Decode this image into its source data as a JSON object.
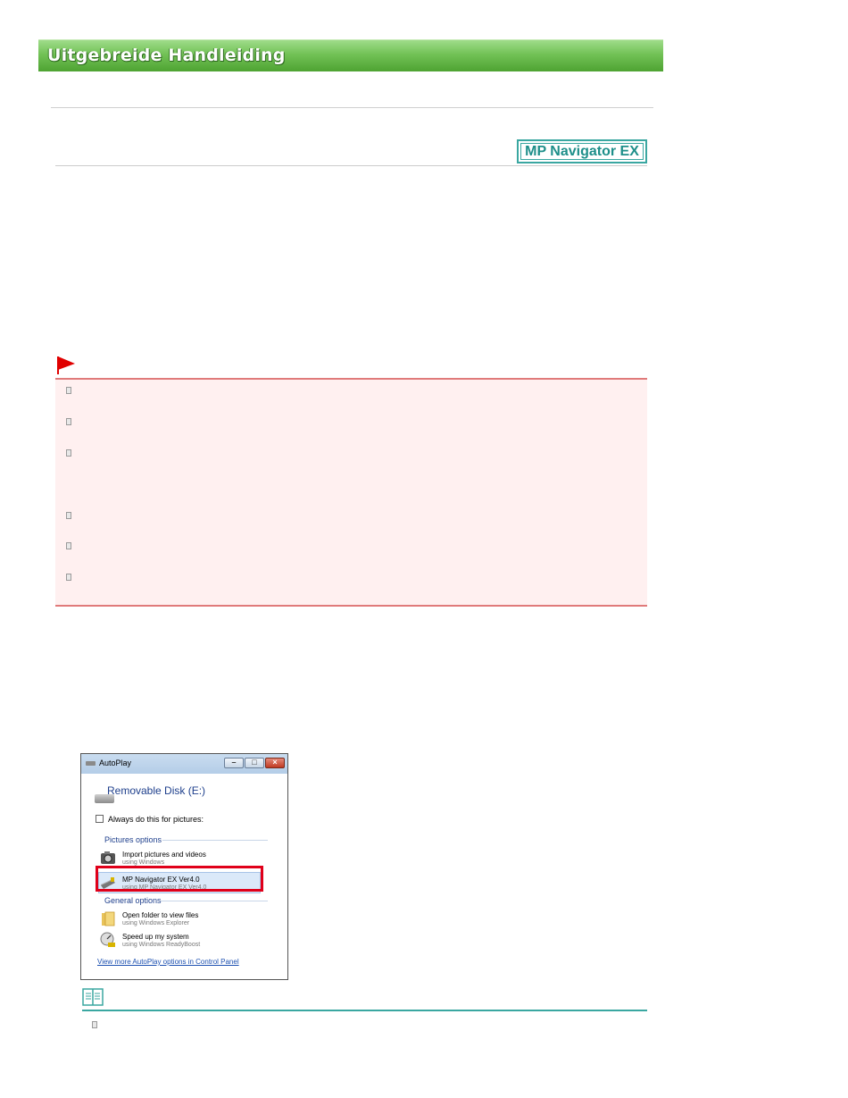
{
  "header": {
    "title": "Uitgebreide Handleiding"
  },
  "badge": {
    "label": "MP Navigator EX"
  },
  "dialog": {
    "title": "AutoPlay",
    "heading": "Removable Disk (E:)",
    "checkbox_label": "Always do this for pictures:",
    "sections": {
      "pictures": "Pictures options",
      "general": "General options"
    },
    "options": [
      {
        "title": "Import pictures and videos",
        "sub": "using Windows"
      },
      {
        "title": "MP Navigator EX Ver4.0",
        "sub": "using MP Navigator EX Ver4.0"
      },
      {
        "title": "Open folder to view files",
        "sub": "using Windows Explorer"
      },
      {
        "title": "Speed up my system",
        "sub": "using Windows ReadyBoost"
      }
    ],
    "link": "View more AutoPlay options in Control Panel"
  },
  "colors": {
    "header_green": "#4ea332",
    "badge_teal": "#1e8f8a",
    "important_border": "#e07a7a",
    "important_bg": "#fff0f0",
    "highlight_red": "#e0001a",
    "note_teal": "#3aa7a1"
  },
  "icons": {
    "important": "red-flag-icon",
    "note": "open-book-icon",
    "bullet": "square-bullet-icon"
  }
}
